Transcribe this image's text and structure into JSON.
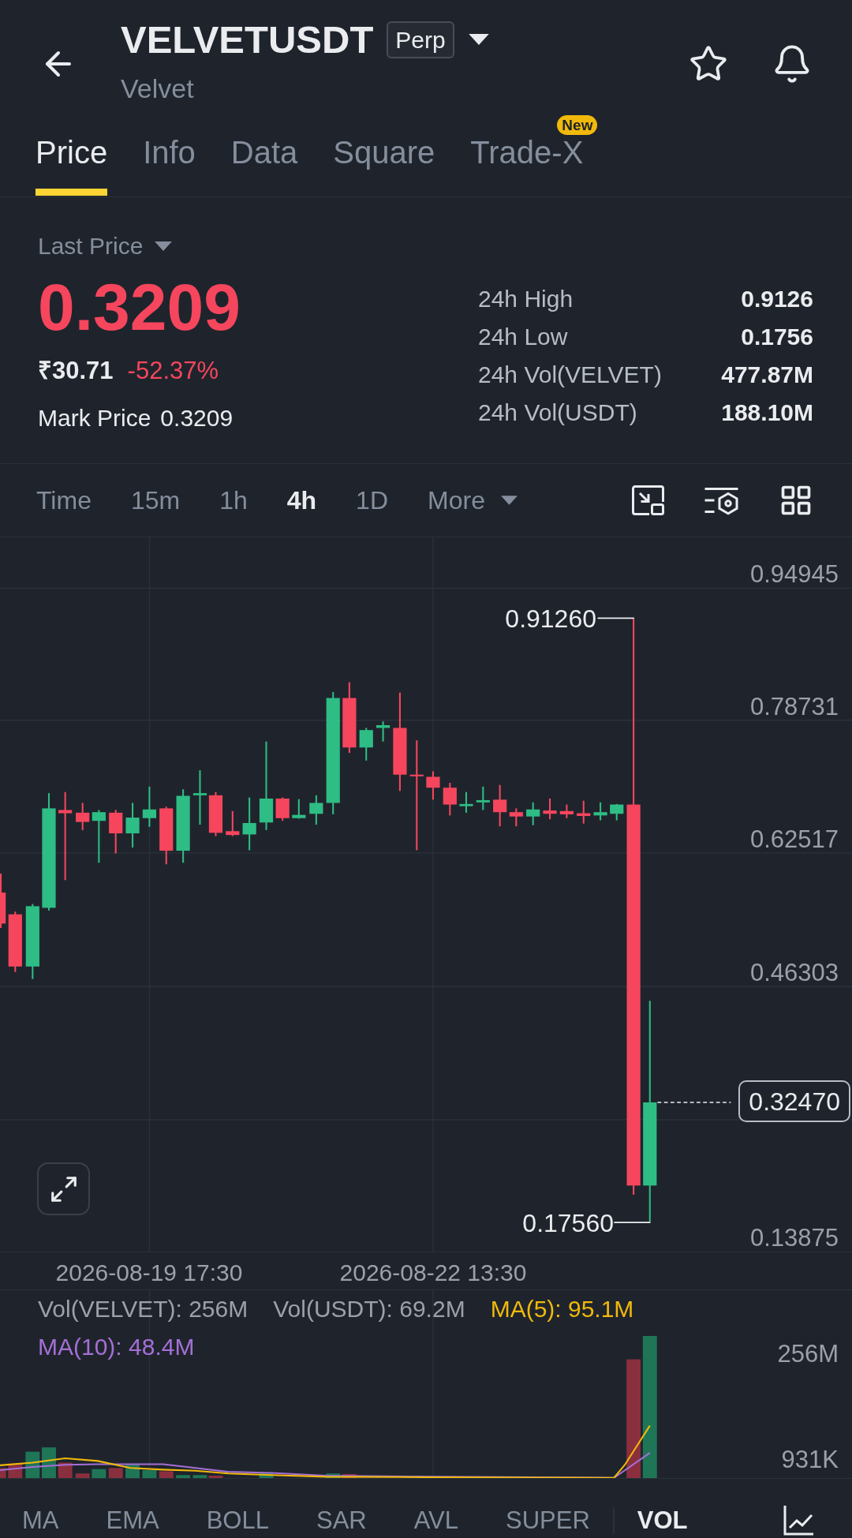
{
  "header": {
    "title": "VELVETUSDT",
    "badge": "Perp",
    "subtitle": "Velvet"
  },
  "tabs": [
    {
      "label": "Price",
      "selected": true
    },
    {
      "label": "Info",
      "selected": false
    },
    {
      "label": "Data",
      "selected": false
    },
    {
      "label": "Square",
      "selected": false
    },
    {
      "label": "Trade-X",
      "selected": false,
      "badge": "New"
    }
  ],
  "price": {
    "label": "Last Price",
    "last": "0.3209",
    "falling": true,
    "fiat": "₹30.71",
    "change": "-52.37%",
    "mark_label": "Mark Price",
    "mark": "0.3209"
  },
  "stats": [
    {
      "label": "24h High",
      "value": "0.9126"
    },
    {
      "label": "24h Low",
      "value": "0.1756"
    },
    {
      "label": "24h Vol(VELVET)",
      "value": "477.87M"
    },
    {
      "label": "24h Vol(USDT)",
      "value": "188.10M"
    }
  ],
  "intervals": [
    {
      "label": "Time",
      "selected": false
    },
    {
      "label": "15m",
      "selected": false
    },
    {
      "label": "1h",
      "selected": false
    },
    {
      "label": "4h",
      "selected": true
    },
    {
      "label": "1D",
      "selected": false
    }
  ],
  "more": {
    "label": "More"
  },
  "chart": {
    "price_axis": [
      "0.94945",
      "0.78731",
      "0.62517",
      "0.46303",
      "0.13875"
    ],
    "high": "0.91260",
    "low": "0.17560",
    "current": "0.32470",
    "time_axis": [
      "2026-08-19 17:30",
      "2026-08-22 13:30"
    ]
  },
  "volume": {
    "legend": [
      {
        "text": "Vol(VELVET): 256M",
        "color": "#9ba1ab"
      },
      {
        "text": "Vol(USDT): 69.2M",
        "color": "#9ba1ab"
      },
      {
        "text": "MA(5): 95.1M",
        "color": "#f0b90b"
      },
      {
        "text": "MA(10): 48.4M",
        "color": "#a46fd6"
      }
    ],
    "axis": [
      "256M",
      "931K"
    ]
  },
  "main_indicators": [
    {
      "label": "MA",
      "selected": false
    },
    {
      "label": "EMA",
      "selected": false
    },
    {
      "label": "BOLL",
      "selected": false
    },
    {
      "label": "SAR",
      "selected": false
    },
    {
      "label": "AVL",
      "selected": false
    },
    {
      "label": "SUPER",
      "selected": false
    }
  ],
  "sub_indicators": [
    {
      "label": "VOL",
      "selected": true
    }
  ]
}
